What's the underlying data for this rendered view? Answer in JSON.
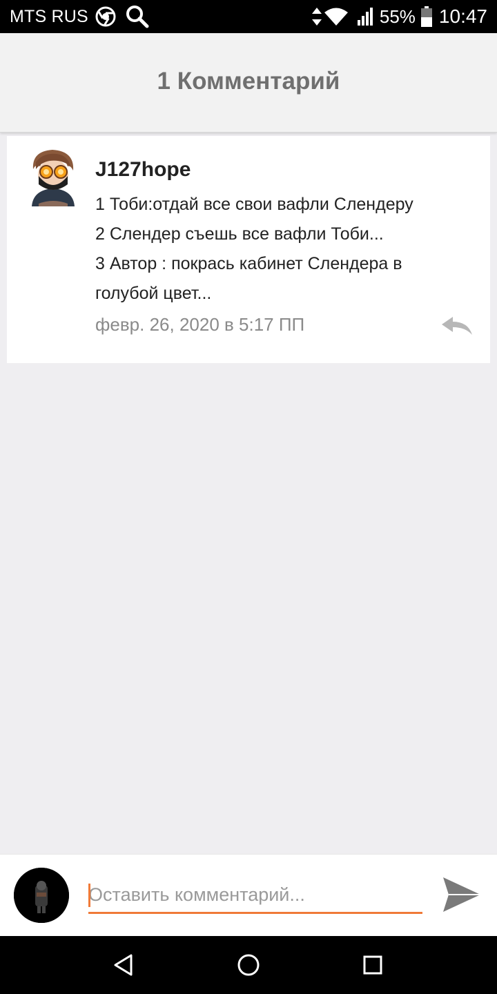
{
  "status_bar": {
    "carrier": "MTS RUS",
    "battery": "55%",
    "time": "10:47",
    "icons": [
      "chrome-icon",
      "search-icon",
      "data-arrows-icon",
      "wifi-icon",
      "signal-icon",
      "battery-icon"
    ]
  },
  "header": {
    "title": "1 Комментарий"
  },
  "comment": {
    "author": "J127hope",
    "lines": [
      "1  Тоби:отдай все свои вафли Слендеру",
      "2 Слендер съешь все вафли Тоби...",
      "3 Автор : покрась кабинет Слендера в",
      "голубой цвет..."
    ],
    "date": "февр. 26, 2020 в 5:17 ПП",
    "reply_icon": "reply-arrow-icon"
  },
  "compose": {
    "placeholder": "Оставить комментарий...",
    "send_icon": "send-icon",
    "accent_color": "#f07a38"
  },
  "nav": {
    "icons": [
      "back-triangle-icon",
      "home-circle-icon",
      "recents-square-icon"
    ]
  }
}
